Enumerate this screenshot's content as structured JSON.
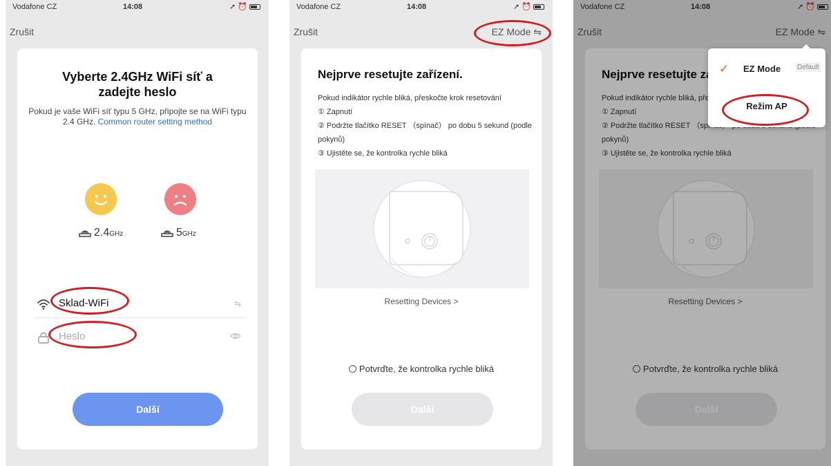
{
  "colors": {
    "accent": "#6b95ef",
    "link": "#2f6fd6",
    "highlight_ring": "#d01f24",
    "check": "#e85f24"
  },
  "statusbar": {
    "carrier": "Vodafone CZ",
    "time": "14:08"
  },
  "screen1": {
    "cancel": "Zrušit",
    "title_line1": "Vyberte 2.4GHz WiFi síť a",
    "title_line2": "zadejte heslo",
    "subtitle": "Pokud je vaše WiFi síť typu 5 GHz, připojte se na WiFi typu 2.4 GHz.",
    "router_link": "Common router setting method",
    "band_24": "2.4",
    "band_5": "5",
    "band_unit": "GHz",
    "ssid_value": "Sklad-WiFi",
    "password_placeholder": "Heslo",
    "next_button": "Další",
    "icons": [
      "wifi-icon",
      "swap-icon",
      "lock-icon",
      "eye-icon",
      "router-icon",
      "smile-icon",
      "sad-icon"
    ]
  },
  "screen2": {
    "cancel": "Zrušit",
    "mode": "EZ Mode",
    "title": "Nejprve resetujte zařízení.",
    "steps": [
      "Pokud indikátor rychle bliká, přeskočte krok resetování",
      "① Zapnutí",
      "② Podržte tlačítko RESET （spínač） po dobu 5 sekund (podle pokynů)",
      "③ Ujistěte se, že kontrolka rychle bliká"
    ],
    "reset_link": "Resetting Devices >",
    "confirm": "Potvrďte, že kontrolka rychle bliká",
    "next_button": "Další"
  },
  "screen3": {
    "cancel": "Zrušit",
    "mode": "EZ Mode",
    "title": "Nejprve resetujte zařízení.",
    "steps": [
      "Pokud indikátor rychle bliká, přeskočte krok resetování",
      "① Zapnutí",
      "② Podržte tlačítko RESET （spínač） po dobu 5 sekund (podle pokynů)",
      "③ Ujistěte se, že kontrolka rychle bliká"
    ],
    "reset_link": "Resetting Devices >",
    "confirm": "Potvrďte, že kontrolka rychle bliká",
    "next_button": "Další",
    "menu": {
      "ez_mode": "EZ Mode",
      "default_badge": "Default",
      "ap_mode": "Režim AP"
    }
  }
}
